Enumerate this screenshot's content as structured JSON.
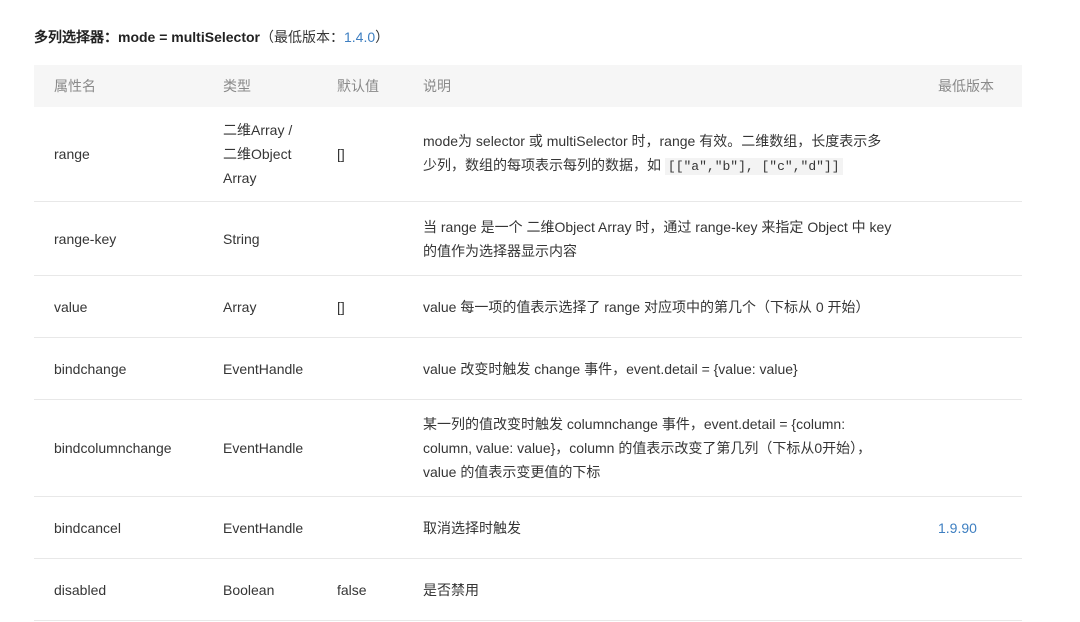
{
  "heading": {
    "title_bold": "多列选择器：mode = multiSelector",
    "paren_open": "（最低版本：",
    "version": "1.4.0",
    "paren_close": "）"
  },
  "table": {
    "headers": [
      "属性名",
      "类型",
      "默认值",
      "说明",
      "最低版本"
    ],
    "rows": [
      {
        "name": "range",
        "type_line1": "二维Array /",
        "type_line2": "二维Object",
        "type_line3": "Array",
        "default": "[]",
        "desc": "mode为 selector 或 multiSelector 时，range 有效。二维数组，长度表示多少列，数组的每项表示每列的数据，如 ",
        "desc_code": "[[\"a\",\"b\"], [\"c\",\"d\"]]",
        "version": ""
      },
      {
        "name": "range-key",
        "type": "String",
        "default": "",
        "desc": "当 range 是一个 二维Object Array 时，通过 range-key 来指定 Object 中 key 的值作为选择器显示内容",
        "version": ""
      },
      {
        "name": "value",
        "type": "Array",
        "default": "[]",
        "desc": "value 每一项的值表示选择了 range 对应项中的第几个（下标从 0 开始）",
        "version": ""
      },
      {
        "name": "bindchange",
        "type": "EventHandle",
        "default": "",
        "desc": "value 改变时触发 change 事件，event.detail = {value: value}",
        "version": ""
      },
      {
        "name": "bindcolumnchange",
        "type": "EventHandle",
        "default": "",
        "desc": "某一列的值改变时触发 columnchange 事件，event.detail = {column: column, value: value}，column 的值表示改变了第几列（下标从0开始），value 的值表示变更值的下标",
        "version": ""
      },
      {
        "name": "bindcancel",
        "type": "EventHandle",
        "default": "",
        "desc": "取消选择时触发",
        "version": "1.9.90"
      },
      {
        "name": "disabled",
        "type": "Boolean",
        "default": "false",
        "desc": "是否禁用",
        "version": ""
      }
    ]
  },
  "colors": {
    "link": "#3e7fc1",
    "header_bg": "#f6f6f6",
    "border": "#e8e8e8"
  }
}
